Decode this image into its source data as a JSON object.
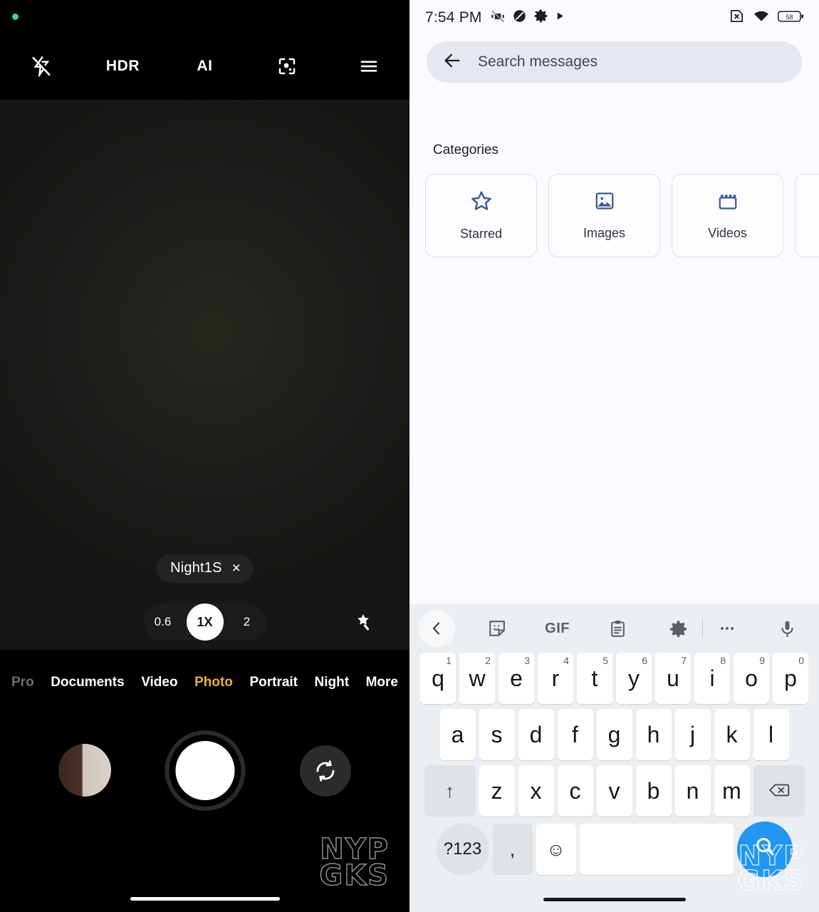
{
  "camera": {
    "recording_indicator": "green-dot",
    "topbar": [
      {
        "name": "flash-off-icon",
        "label": "",
        "icon": "flash-off"
      },
      {
        "name": "hdr-toggle",
        "label": "HDR",
        "icon": "text"
      },
      {
        "name": "ai-toggle",
        "label": "AI",
        "icon": "text"
      },
      {
        "name": "lens-scan-icon",
        "label": "",
        "icon": "google-lens"
      },
      {
        "name": "menu-icon",
        "label": "",
        "icon": "hamburger"
      }
    ],
    "scene_chip": {
      "label": "Night1S",
      "close": "×"
    },
    "zoom_levels": [
      {
        "label": "0.6",
        "active": false
      },
      {
        "label": "1X",
        "active": true
      },
      {
        "label": "2",
        "active": false
      }
    ],
    "magic_wand": "magic-wand-icon",
    "modes": [
      {
        "label": "Pro",
        "state": "dim"
      },
      {
        "label": "Documents",
        "state": "normal"
      },
      {
        "label": "Video",
        "state": "normal"
      },
      {
        "label": "Photo",
        "state": "selected"
      },
      {
        "label": "Portrait",
        "state": "normal"
      },
      {
        "label": "Night",
        "state": "normal"
      },
      {
        "label": "More",
        "state": "normal"
      }
    ],
    "gallery_thumbnail": "last-photo-thumbnail",
    "shutter": "shutter-button",
    "flip_camera": "flip-camera-icon",
    "watermark": {
      "line1": "NYP",
      "line2": "GKS"
    },
    "accent_selected": "#e3b23c"
  },
  "messages": {
    "statusbar": {
      "time": "7:54 PM",
      "left_icons": [
        "vibrate-off-icon",
        "do-not-disturb-icon",
        "gear-icon",
        "play-icon"
      ],
      "right_icons": [
        "no-sim-icon",
        "wifi-icon"
      ],
      "battery_level": "58"
    },
    "search": {
      "back": "back-arrow-icon",
      "placeholder": "Search messages",
      "value": ""
    },
    "categories_title": "Categories",
    "categories": [
      {
        "label": "Starred",
        "icon": "star-icon"
      },
      {
        "label": "Images",
        "icon": "image-icon"
      },
      {
        "label": "Videos",
        "icon": "video-clapper-icon"
      },
      {
        "label": "",
        "icon": ""
      }
    ],
    "accent": "#3b5a96"
  },
  "keyboard": {
    "toolbar": [
      {
        "name": "collapse-toolbar-button",
        "icon": "chevron-left-icon",
        "label": ""
      },
      {
        "name": "sticker-button",
        "icon": "sticker-icon",
        "label": ""
      },
      {
        "name": "gif-button",
        "icon": "text",
        "label": "GIF"
      },
      {
        "name": "clipboard-button",
        "icon": "clipboard-icon",
        "label": ""
      },
      {
        "name": "keyboard-settings-button",
        "icon": "gear-icon",
        "label": ""
      },
      {
        "name": "more-options-button",
        "icon": "ellipsis-icon",
        "label": ""
      },
      {
        "name": "voice-input-button",
        "icon": "microphone-icon",
        "label": ""
      }
    ],
    "row1": [
      {
        "key": "q",
        "sup": "1"
      },
      {
        "key": "w",
        "sup": "2"
      },
      {
        "key": "e",
        "sup": "3"
      },
      {
        "key": "r",
        "sup": "4"
      },
      {
        "key": "t",
        "sup": "5"
      },
      {
        "key": "y",
        "sup": "6"
      },
      {
        "key": "u",
        "sup": "7"
      },
      {
        "key": "i",
        "sup": "8"
      },
      {
        "key": "o",
        "sup": "9"
      },
      {
        "key": "p",
        "sup": "0"
      }
    ],
    "row2": [
      {
        "key": "a"
      },
      {
        "key": "s"
      },
      {
        "key": "d"
      },
      {
        "key": "f"
      },
      {
        "key": "g"
      },
      {
        "key": "h"
      },
      {
        "key": "j"
      },
      {
        "key": "k"
      },
      {
        "key": "l"
      }
    ],
    "row3": [
      {
        "key": "z"
      },
      {
        "key": "x"
      },
      {
        "key": "c"
      },
      {
        "key": "v"
      },
      {
        "key": "b"
      },
      {
        "key": "n"
      },
      {
        "key": "m"
      }
    ],
    "shift_key": "↑",
    "backspace_key": "backspace-icon",
    "symbols_key": "?123",
    "comma_key": ",",
    "emoji_key": "☺",
    "space_key": "",
    "search_key": "search-icon",
    "search_key_color": "#2196f3",
    "watermark": {
      "line1": "NYP",
      "line2": "GKS"
    }
  }
}
